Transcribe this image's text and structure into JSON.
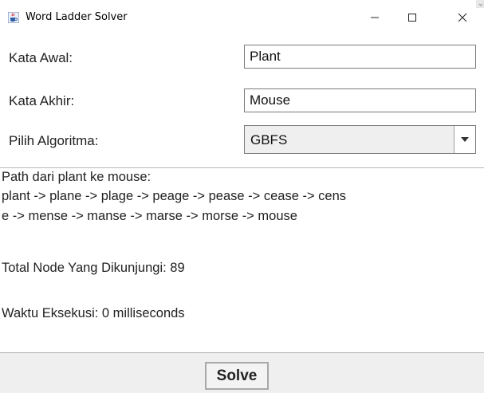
{
  "window": {
    "title": "Word Ladder Solver",
    "icons": {
      "app": "java-cup-icon",
      "minimize": "minimize-icon",
      "maximize": "maximize-icon",
      "close": "close-icon"
    }
  },
  "form": {
    "start_label": "Kata Awal:",
    "start_value": "Plant",
    "end_label": "Kata Akhir:",
    "end_value": "Mouse",
    "algo_label": "Pilih Algoritma:",
    "algo_value": "GBFS"
  },
  "output": {
    "lines": [
      "Path dari plant ke mouse:",
      "plant -> plane -> plage -> peage -> pease -> cease -> cens",
      "e -> mense -> manse -> marse -> morse -> mouse",
      "",
      "Total Node Yang Dikunjungi: 89",
      "",
      "Waktu Eksekusi: 0 milliseconds"
    ]
  },
  "actions": {
    "solve_label": "Solve"
  },
  "colors": {
    "field_border": "#7a7a7a",
    "panel_bg": "#efefef",
    "text": "#222222"
  }
}
